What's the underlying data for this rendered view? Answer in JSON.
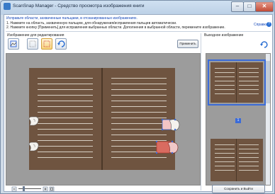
{
  "window": {
    "title": "ScanSnap Manager - Средство просмотра изображения книги",
    "min_label": "–",
    "max_label": "□",
    "close_label": "✕"
  },
  "instructions": {
    "heading": "Исправьте области, захваченные пальцами, в отсканированных изображениях.",
    "line1": "1. Нажмите на область, захваченную пальцем, для обнаружения/исправления пальцев автоматически.",
    "line2": "2. Нажмите кнопку [Применить] для исправления выбранных области. Дополнения в выбранной области, перемените изображение.",
    "help_label": "Справка"
  },
  "editor": {
    "label": "Изображение для редактирования",
    "apply_label": "Применить"
  },
  "preview": {
    "label": "Выходное изображение",
    "page_number": "1"
  },
  "footer": {
    "save_label": "Сохранить и Выйти"
  },
  "colors": {
    "selection": "#3a6bd9",
    "marker": "#d0453a",
    "page": "#6f5440"
  }
}
